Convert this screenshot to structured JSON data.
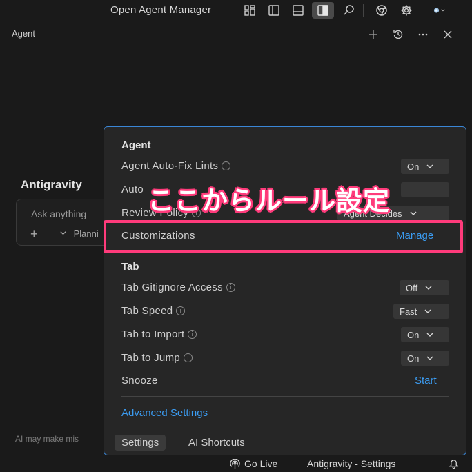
{
  "titlebar": {
    "title": "Open Agent Manager"
  },
  "panel": {
    "title": "Agent"
  },
  "background": {
    "heading": "Antigravity",
    "chat_placeholder": "Ask anything",
    "chat_plus": "+",
    "chat_mode": "Planni",
    "disclaimer": "AI may make mis"
  },
  "popup": {
    "agent_section": "Agent",
    "rows": {
      "auto_fix": {
        "label": "Agent Auto-Fix Lints",
        "value": "On"
      },
      "auto_execution": {
        "label": "Auto",
        "value": ""
      },
      "review_policy": {
        "label": "Review Policy",
        "value": "Agent Decides"
      },
      "customizations": {
        "label": "Customizations",
        "action": "Manage"
      }
    },
    "tab_section": "Tab",
    "tab_rows": {
      "gitignore": {
        "label": "Tab Gitignore Access",
        "value": "Off"
      },
      "speed": {
        "label": "Tab Speed",
        "value": "Fast"
      },
      "import": {
        "label": "Tab to Import",
        "value": "On"
      },
      "jump": {
        "label": "Tab to Jump",
        "value": "On"
      },
      "snooze": {
        "label": "Snooze",
        "action": "Start"
      }
    },
    "advanced_link": "Advanced Settings",
    "footer": {
      "settings_tab": "Settings",
      "shortcuts_tab": "AI Shortcuts"
    }
  },
  "annotation": {
    "text": "ここからルール設定",
    "color": "#ff3b7b"
  },
  "statusbar": {
    "go_live": "Go Live",
    "settings": "Antigravity - Settings"
  },
  "colors": {
    "accent": "#3b9bf0",
    "popup_border": "#3a86d6",
    "background": "#1a1a1a"
  }
}
